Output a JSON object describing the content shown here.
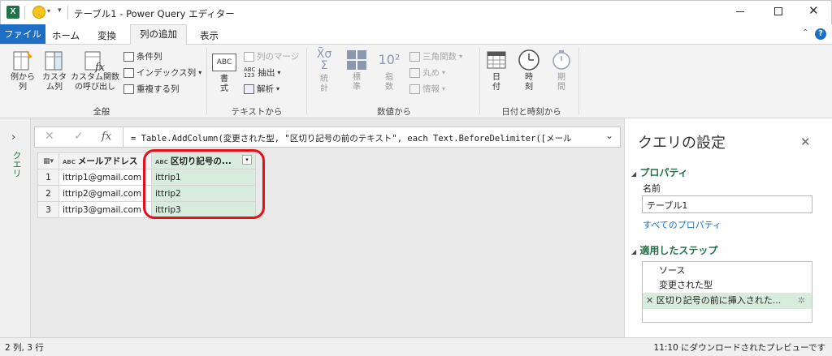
{
  "title": "テーブル1 - Power Query エディター",
  "tabs": {
    "file": "ファイル",
    "home": "ホーム",
    "transform": "変換",
    "add_column": "列の追加",
    "view": "表示"
  },
  "ribbon": {
    "general": {
      "col_from_examples": "例から\n列",
      "custom_column": "カスタ\nム列",
      "invoke_custom_function": "カスタム関数\nの呼び出し",
      "conditional_column": "条件列",
      "index_column": "インデックス列",
      "duplicate_column": "重複する列",
      "group_label": "全般"
    },
    "text": {
      "format": "書\n式",
      "merge_columns": "列のマージ",
      "extract": "抽出",
      "parse": "解析",
      "abc_icon_text": "ABC",
      "group_label": "テキストから"
    },
    "number": {
      "statistics": "統\n計",
      "standard": "標\n準",
      "scientific": "指\n数",
      "scientific_icon_text": "10²",
      "trigonometry": "三角関数",
      "rounding": "丸め",
      "information": "情報",
      "group_label": "数値から"
    },
    "datetime": {
      "date": "日\n付",
      "time": "時\n刻",
      "duration": "期\n間",
      "group_label": "日付と時刻から"
    }
  },
  "left_panel": {
    "label": "クエリ"
  },
  "formula_bar": {
    "formula": "= Table.AddColumn(変更された型, \"区切り記号の前のテキスト\", each Text.BeforeDelimiter([メール",
    "fx": "fx"
  },
  "grid": {
    "type_icon": "ABC",
    "columns": [
      {
        "name": "メールアドレス",
        "type": "ABC"
      },
      {
        "name": "区切り記号の...",
        "type": "ABC"
      }
    ],
    "rows": [
      {
        "index": "1",
        "email": "ittrip1@gmail.com",
        "before": "ittrip1"
      },
      {
        "index": "2",
        "email": "ittrip2@gmail.com",
        "before": "ittrip2"
      },
      {
        "index": "3",
        "email": "ittrip3@gmail.com",
        "before": "ittrip3"
      }
    ]
  },
  "query_settings": {
    "title": "クエリの設定",
    "properties_label": "プロパティ",
    "name_label": "名前",
    "name_value": "テーブル1",
    "all_properties": "すべてのプロパティ",
    "applied_steps_label": "適用したステップ",
    "steps": [
      "ソース",
      "変更された型",
      "区切り記号の前に挿入された..."
    ]
  },
  "status": {
    "left": "2 列, 3 行",
    "right": "11:10 にダウンロードされたプレビューです"
  },
  "colors": {
    "accent_blue": "#1e6fc4",
    "green": "#217346",
    "highlight_red": "#e2111a",
    "selected_col": "#d7ecdc"
  }
}
